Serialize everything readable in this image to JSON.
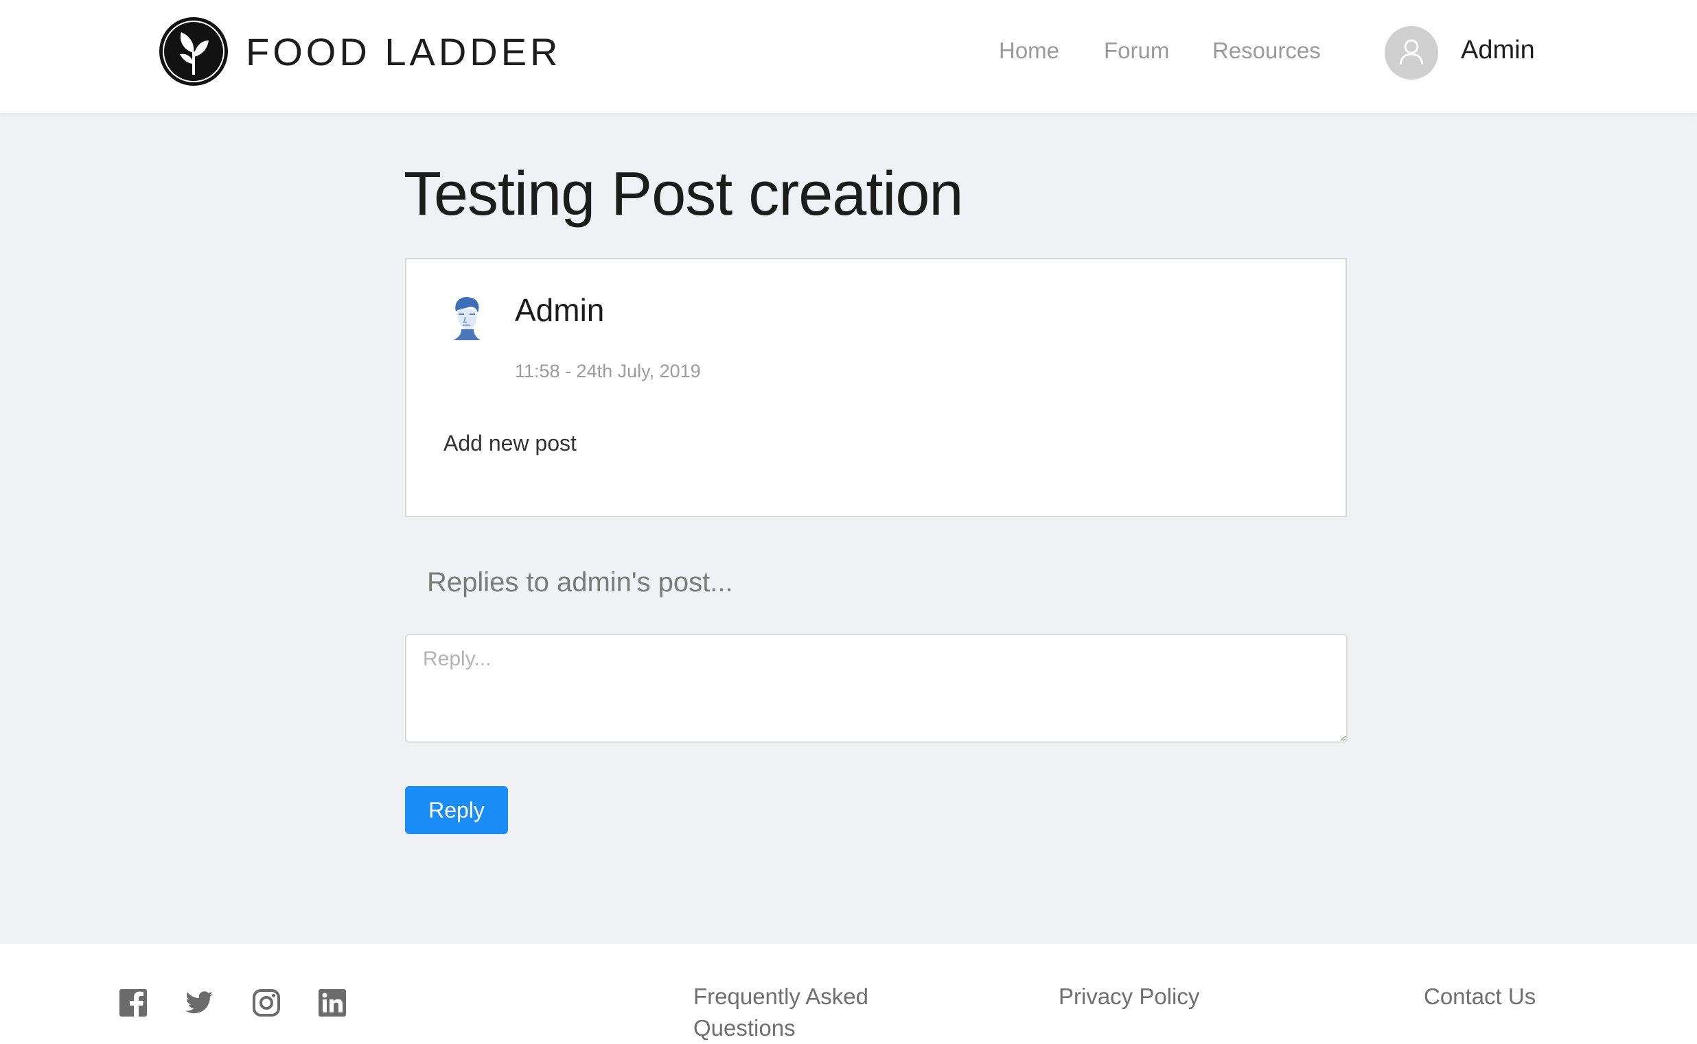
{
  "header": {
    "brand": "FOOD LADDER",
    "nav": [
      {
        "label": "Home"
      },
      {
        "label": "Forum"
      },
      {
        "label": "Resources"
      }
    ],
    "user": {
      "name": "Admin",
      "icon": "user-icon"
    }
  },
  "post": {
    "title": "Testing Post creation",
    "author": "Admin",
    "timestamp": "11:58 - 24th July, 2019",
    "body": "Add new post"
  },
  "replies": {
    "heading": "Replies to admin's post...",
    "input_placeholder": "Reply...",
    "button_label": "Reply"
  },
  "footer": {
    "social": [
      "facebook-icon",
      "twitter-icon",
      "instagram-icon",
      "linkedin-icon"
    ],
    "links": [
      {
        "label": "Frequently Asked Questions"
      },
      {
        "label": "Privacy Policy"
      },
      {
        "label": "Contact Us"
      }
    ]
  },
  "colors": {
    "background": "#f0f1f5",
    "primary": "#1a8cf5",
    "nav_text": "#9a9a9a",
    "footer_text": "#6f6f6f"
  }
}
